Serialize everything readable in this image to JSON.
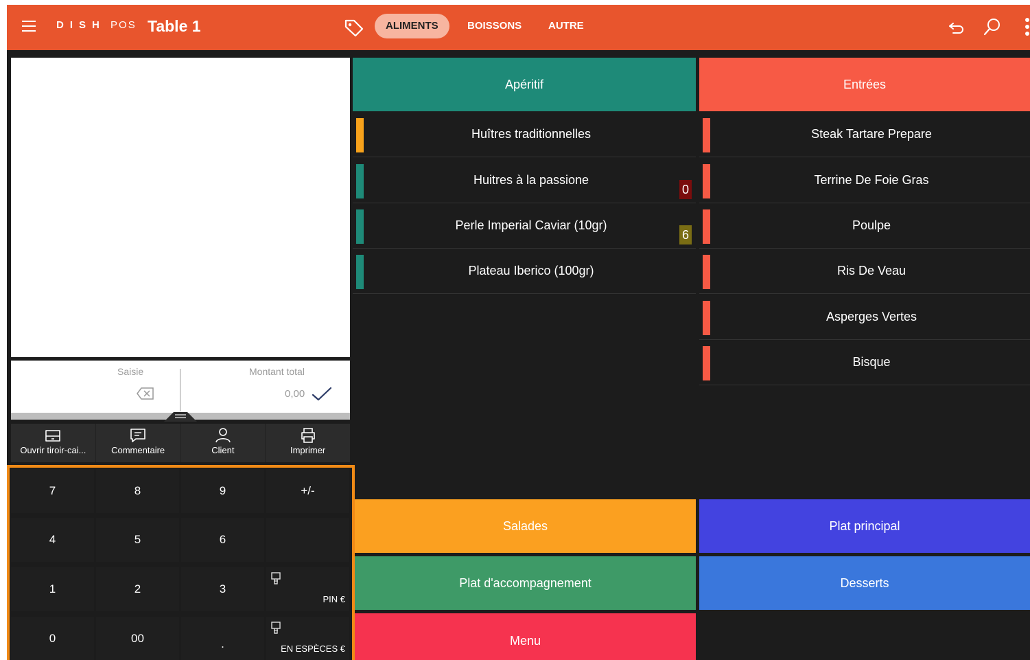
{
  "header": {
    "logo_main": "DISH",
    "logo_sub": "POS",
    "table_title": "Table 1",
    "tabs": [
      {
        "label": "ALIMENTS",
        "active": true
      },
      {
        "label": "BOISSONS",
        "active": false
      },
      {
        "label": "AUTRE",
        "active": false
      }
    ],
    "icons": [
      "menu-icon",
      "tag-icon",
      "undo-icon",
      "search-icon",
      "more-vert-icon"
    ],
    "bar_color": "#e8552d"
  },
  "input_panel": {
    "entry_label": "Saisie",
    "total_label": "Montant total",
    "total_value": "0,00"
  },
  "actions": [
    {
      "label": "Ouvrir tiroir-cai...",
      "icon": "drawer-icon"
    },
    {
      "label": "Commentaire",
      "icon": "comment-icon"
    },
    {
      "label": "Client",
      "icon": "user-icon"
    },
    {
      "label": "Imprimer",
      "icon": "printer-icon"
    }
  ],
  "keypad": {
    "keys": [
      "7",
      "8",
      "9",
      "+/-",
      "4",
      "5",
      "6",
      "",
      "1",
      "2",
      "3",
      "PIN €",
      "0",
      "00",
      ".",
      "EN ESPÈCES €"
    ],
    "highlight_color": "#f08a16"
  },
  "categories": {
    "aperitif": {
      "label": "Apéritif",
      "color": "#1e8a78"
    },
    "entrees": {
      "label": "Entrées",
      "color": "#f75a45"
    },
    "salades": {
      "label": "Salades",
      "color": "#fba020"
    },
    "plat_principal": {
      "label": "Plat principal",
      "color": "#4343e0"
    },
    "plat_accompagnement": {
      "label": "Plat d'accompagnement",
      "color": "#3e9a67"
    },
    "desserts": {
      "label": "Desserts",
      "color": "#3a77dc"
    },
    "menu": {
      "label": "Menu",
      "color": "#f6334f"
    }
  },
  "aperitif_items": [
    {
      "label": "Huîtres traditionnelles",
      "bar": "#f7a21b",
      "badge": ""
    },
    {
      "label": "Huitres à la passione",
      "bar": "#1e8a78",
      "badge": "0",
      "badge_color": "#7a0d0d"
    },
    {
      "label": "Perle Imperial Caviar (10gr)",
      "bar": "#1e8a78",
      "badge": "6",
      "badge_color": "#7a6d14"
    },
    {
      "label": "Plateau Iberico (100gr)",
      "bar": "#1e8a78",
      "badge": ""
    }
  ],
  "entrees_items": [
    {
      "label": "Steak Tartare Prepare",
      "bar": "#f75a45"
    },
    {
      "label": "Terrine De Foie Gras",
      "bar": "#f75a45"
    },
    {
      "label": "Poulpe",
      "bar": "#f75a45"
    },
    {
      "label": "Ris De Veau",
      "bar": "#f75a45"
    },
    {
      "label": "Asperges Vertes",
      "bar": "#f75a45"
    },
    {
      "label": "Bisque",
      "bar": "#f75a45"
    }
  ]
}
